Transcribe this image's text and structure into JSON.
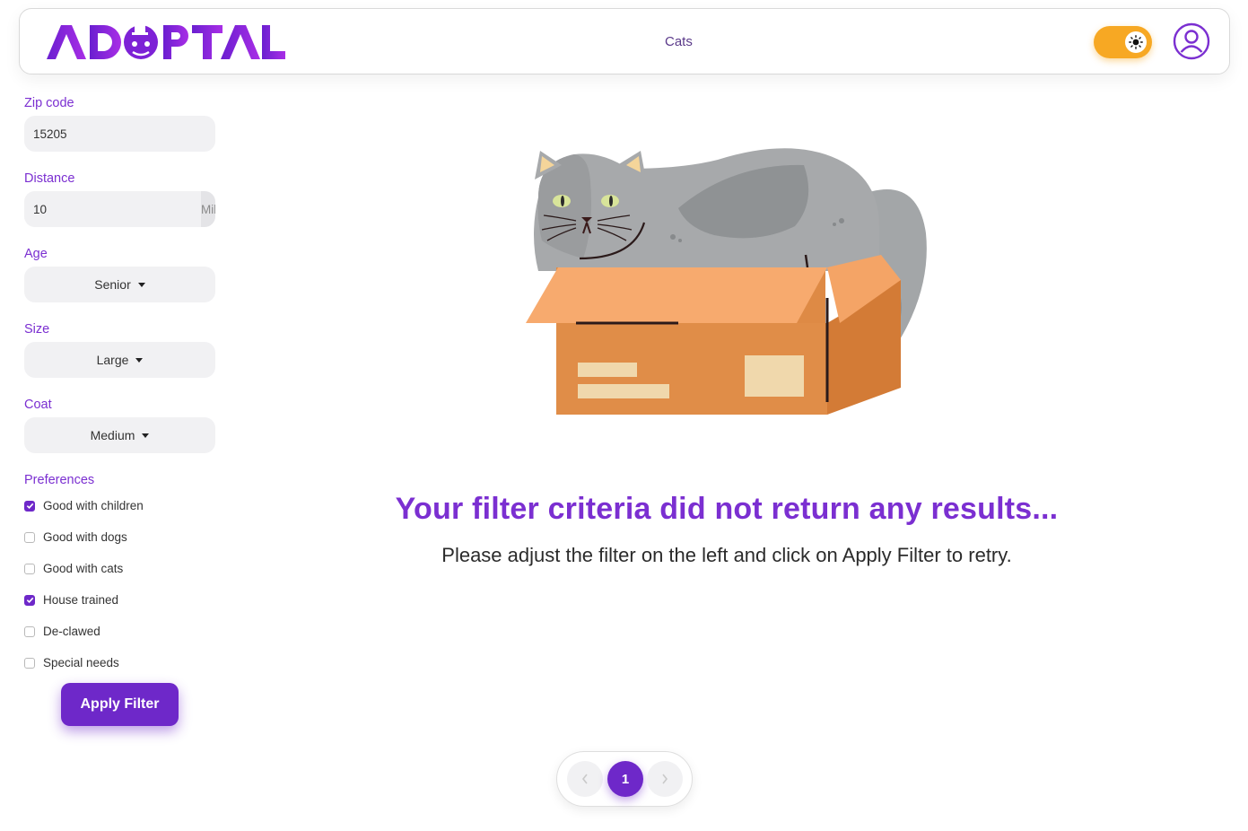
{
  "header": {
    "logo_text": "ADOPTAL",
    "nav_link": "Cats",
    "theme_toggle_icon": "sun-icon",
    "account_icon": "user-circle-icon"
  },
  "filters": {
    "zip": {
      "label": "Zip code",
      "value": "15205"
    },
    "distance": {
      "label": "Distance",
      "value": "10",
      "unit": "Miles"
    },
    "age": {
      "label": "Age",
      "value": "Senior"
    },
    "size": {
      "label": "Size",
      "value": "Large"
    },
    "coat": {
      "label": "Coat",
      "value": "Medium"
    },
    "preferences": {
      "label": "Preferences",
      "items": [
        {
          "label": "Good with children",
          "checked": true
        },
        {
          "label": "Good with dogs",
          "checked": false
        },
        {
          "label": "Good with cats",
          "checked": false
        },
        {
          "label": "House trained",
          "checked": true
        },
        {
          "label": "De-clawed",
          "checked": false
        },
        {
          "label": "Special needs",
          "checked": false
        }
      ]
    },
    "apply_label": "Apply Filter"
  },
  "empty_state": {
    "title": "Your filter criteria did not return any results...",
    "subtitle": "Please adjust the filter on the left and click on Apply Filter to retry."
  },
  "pagination": {
    "prev_icon": "chevron-left-icon",
    "current_page": "1",
    "next_icon": "chevron-right-icon"
  },
  "colors": {
    "brand": "#7b2fd1",
    "brand_dark": "#6e28c9",
    "toggle": "#f7a823"
  }
}
